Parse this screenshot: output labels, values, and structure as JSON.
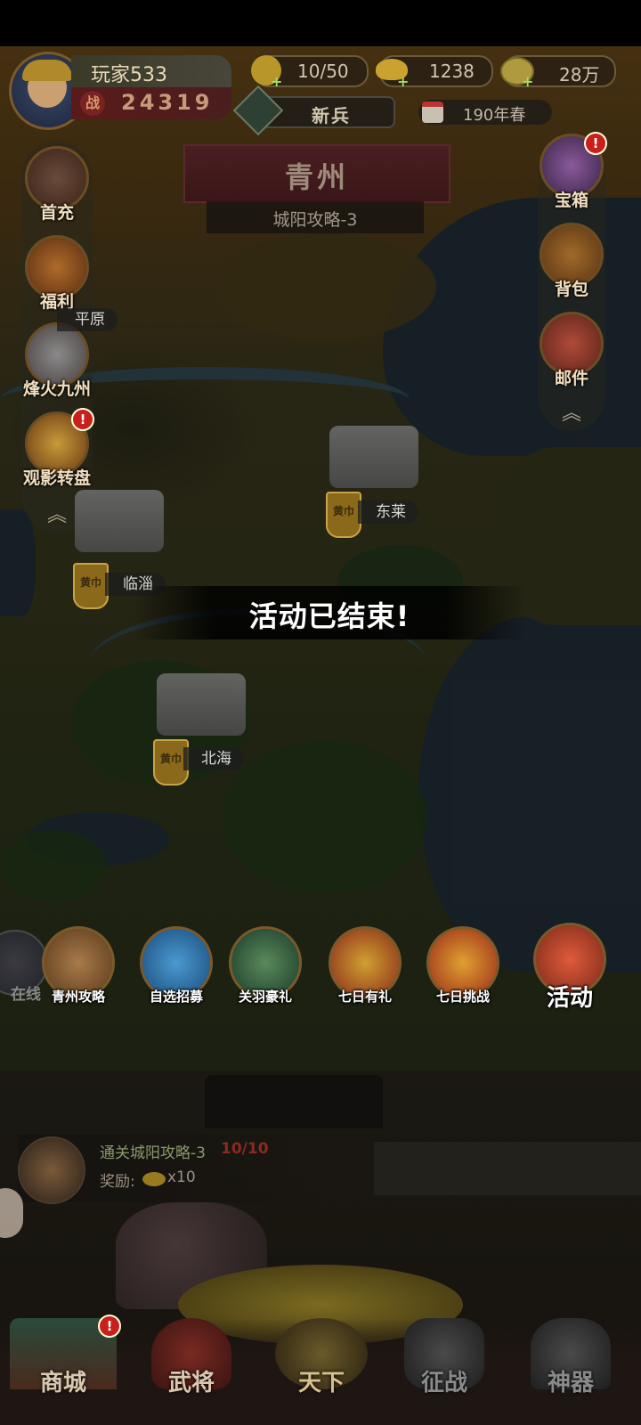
{
  "player": {
    "name": "玩家533",
    "power_icon": "战",
    "power": "24319"
  },
  "resources": {
    "stamina": "10/50",
    "gold": "1238",
    "coins": "28万"
  },
  "rank": "新兵",
  "date": "190年春",
  "region": {
    "title": "青州",
    "subtitle": "城阳攻略-3"
  },
  "left_menu": [
    {
      "label": "首充",
      "icon": "hero-portrait-icon"
    },
    {
      "label": "福利",
      "icon": "gift-bag-icon"
    },
    {
      "label": "烽火九州",
      "icon": "castle-tower-icon"
    },
    {
      "label": "观影转盘",
      "icon": "spin-wheel-icon",
      "badge": "!"
    }
  ],
  "right_menu": [
    {
      "label": "宝箱",
      "icon": "treasure-chest-icon",
      "badge": "!"
    },
    {
      "label": "背包",
      "icon": "backpack-icon"
    },
    {
      "label": "邮件",
      "icon": "mail-icon"
    }
  ],
  "cities": [
    {
      "name": "东莱",
      "flag": "黄巾"
    },
    {
      "name": "临淄",
      "flag": "黄巾"
    },
    {
      "name": "北海",
      "flag": "黄巾"
    }
  ],
  "partial_city": "平原",
  "toast": "活动已结束!",
  "activities": [
    {
      "label": "青州攻略",
      "icon": "scroll-map-icon"
    },
    {
      "label": "自选招募",
      "icon": "recruit-badge-icon"
    },
    {
      "label": "关羽豪礼",
      "icon": "guan-yu-portrait-icon"
    },
    {
      "label": "七日有礼",
      "icon": "gift-chest-icon"
    },
    {
      "label": "七日挑战",
      "icon": "battle-chest-icon"
    },
    {
      "label": "活动",
      "icon": "event-scroll-icon"
    }
  ],
  "online_partial": "在线",
  "quest": {
    "text": "通关城阳攻略-3",
    "progress": "10/10",
    "reward_label": "奖励:",
    "reward_count": "x10"
  },
  "bottom_nav": [
    {
      "label": "商城",
      "icon": "shop-gate-icon",
      "badge": "!"
    },
    {
      "label": "武将",
      "icon": "general-helmet-icon"
    },
    {
      "label": "天下",
      "icon": "crossed-swords-icon"
    },
    {
      "label": "征战",
      "icon": "battle-flag-icon"
    },
    {
      "label": "神器",
      "icon": "artifact-icon"
    }
  ],
  "colors": {
    "accent_red": "#c8201c",
    "title_band": "#4a1e22",
    "gold_text": "#f3dfc0"
  }
}
